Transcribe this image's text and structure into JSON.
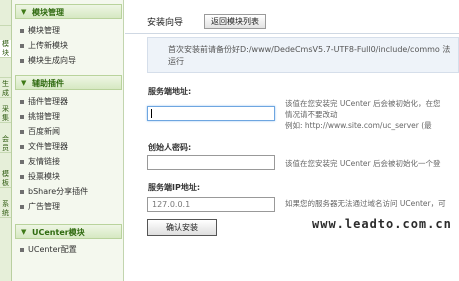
{
  "strip": {
    "tabs": [
      "",
      "模块",
      "",
      "生成",
      "采集",
      "会员",
      "模板",
      "系统"
    ]
  },
  "sidebar": {
    "sections": [
      {
        "title": "模块管理",
        "items": [
          "模块管理",
          "上传新模块",
          "模块生成向导"
        ]
      },
      {
        "title": "辅助插件",
        "items": [
          "插件管理器",
          "挑错管理",
          "百度新闻",
          "文件管理器",
          "友情链接",
          "投票模块",
          "bShare分享插件",
          "广告管理"
        ]
      },
      {
        "title": "UCenter模块",
        "items": [
          "UCenter配置"
        ]
      }
    ]
  },
  "main": {
    "title": "安装向导",
    "back_button": "返回模块列表",
    "info_text": "首次安装前请备份好D:/www/DedeCmsV5.7-UTF8-Full0/include/commo 法运行",
    "fields": [
      {
        "label": "服务端地址:",
        "value": "",
        "hint_lines": [
          "该值在您安装完 UCenter 后会被初始化，在您",
          "情况请不要改动",
          "例如: http://www.site.com/uc_server (最"
        ]
      },
      {
        "label": "创始人密码:",
        "value": "",
        "hint_lines": [
          "该值在您安装完 UCenter 后会被初始化一个登"
        ]
      },
      {
        "label": "服务端IP地址:",
        "value": "127.0.0.1",
        "hint_lines": [
          "如果您的服务器无法通过域名访问 UCenter，可"
        ]
      }
    ],
    "submit_button": "确认安装"
  },
  "watermark": "www.leadto.com.cn"
}
